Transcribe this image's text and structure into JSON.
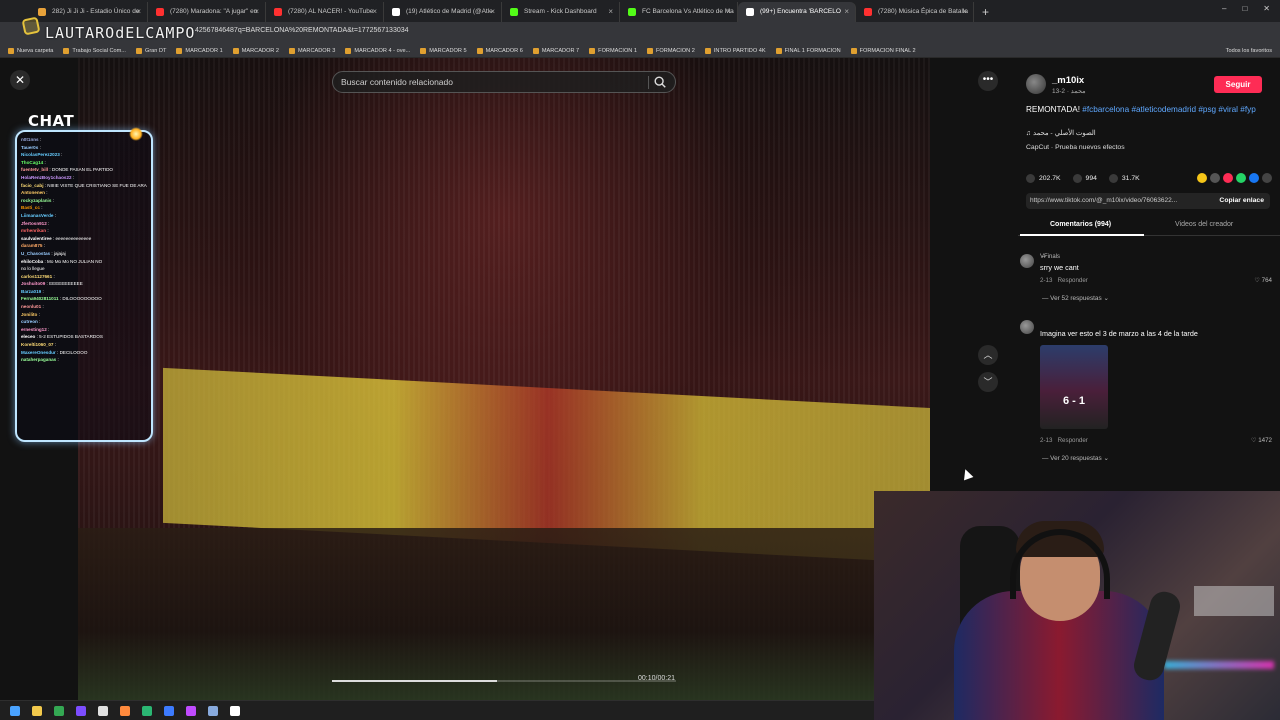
{
  "browser": {
    "tabs": [
      {
        "label": "282) Ji Ji Ji - Estadio Único de",
        "color": "#e8a23a",
        "active": false
      },
      {
        "label": "(7280) Maradona: \"A jugar\" en",
        "color": "#ff3030",
        "active": false
      },
      {
        "label": "(7280) AL NACER! - YouTube",
        "color": "#ff3030",
        "active": false
      },
      {
        "label": "(19) Atlético de Madrid (@Atle",
        "color": "#ffffff",
        "active": false
      },
      {
        "label": "Stream - Kick Dashboard",
        "color": "#53fc18",
        "active": false
      },
      {
        "label": "FC Barcelona Vs Atlético de Ma",
        "color": "#53fc18",
        "active": false
      },
      {
        "label": "(99+) Encuentra 'BARCELO",
        "color": "#ffffff",
        "active": true
      },
      {
        "label": "(7280) Música Épica de Batalla",
        "color": "#ff3030",
        "active": false
      }
    ],
    "new_tab": "+",
    "url": "42567846487q=BARCELONA%20REMONTADA&t=1772567133034",
    "streamer_overlay": "LAUTAROdELCAMPO",
    "bookmarks": [
      "Nueva carpeta",
      "Trabajo Social Com...",
      "Gran DT",
      "MARCADOR 1",
      "MARCADOR 2",
      "MARCADOR 3",
      "MARCADOR 4 - ove...",
      "MARCADOR 5",
      "MARCADOR 6",
      "MARCADOR 7",
      "FORMACION 1",
      "FORMACION 2",
      "INTRO PARTIDO 4K",
      "FINAL 1 FORMACION",
      "FORMACION FINAL 2"
    ],
    "bookmarks_right": "Todos los favoritos"
  },
  "player": {
    "search_placeholder": "Buscar contenido relacionado",
    "timecode": "00:10/00:21",
    "progress": 0.48
  },
  "chat": {
    "title": "CHAT",
    "lines": [
      {
        "user": "n0t1nns",
        "text": ":",
        "color": "#9ad"
      },
      {
        "user": "Tauer0s",
        "text": ":",
        "color": "#9cf"
      },
      {
        "user": "NicolasPerez2023",
        "text": ":",
        "color": "#6cf"
      },
      {
        "user": "ThoCag14",
        "text": ":",
        "color": "#6f6"
      },
      {
        "user": "fuentetv_bill",
        "text": ": DONDE PASAN EL PARTIDO",
        "color": "#f99"
      },
      {
        "user": "HolaRenzBoy1chaos22",
        "text": ":",
        "color": "#c9f"
      },
      {
        "user": "facio_cabj",
        "text": ": NIIIIE VISTE QUE CRISTIANO SE FUE DE ARABIA",
        "color": "#fd7"
      },
      {
        "user": "Antonenen",
        "text": ":",
        "color": "#fc6"
      },
      {
        "user": "rockyzaplanis",
        "text": ":",
        "color": "#9f9"
      },
      {
        "user": "Basti_cc",
        "text": ":",
        "color": "#f90"
      },
      {
        "user": "LiimanasVerde",
        "text": ":",
        "color": "#6cf"
      },
      {
        "user": "Jfertosn912",
        "text": ":",
        "color": "#f9c"
      },
      {
        "user": "mrhenrikan",
        "text": ":",
        "color": "#f66"
      },
      {
        "user": "saulvalentiree",
        "text": ": eeeeeeeeeeeeee",
        "color": "#fff"
      },
      {
        "user": "daram875",
        "text": ":",
        "color": "#fa6"
      },
      {
        "user": "U_Chasostas",
        "text": ": jajajaj",
        "color": "#9cf"
      },
      {
        "user": "ehiloCoba",
        "text": ": Mo Mo Mo NO JULIAN NO",
        "color": "#fff"
      },
      {
        "user": "",
        "text": "no lo llegue",
        "color": "#fff"
      },
      {
        "user": "carlos1127661",
        "text": ":",
        "color": "#fd7"
      },
      {
        "user": "Joshuito09",
        "text": ": EEEEEEEEEEE",
        "color": "#f9c"
      },
      {
        "user": "Barza019",
        "text": ":",
        "color": "#6cf"
      },
      {
        "user": "Ferna9402811011",
        "text": ": DILOOOOOOOOO",
        "color": "#9f9"
      },
      {
        "user": "neonlu01",
        "text": ":",
        "color": "#f99"
      },
      {
        "user": "Jonilito",
        "text": ":",
        "color": "#fc6"
      },
      {
        "user": "cutreon",
        "text": ":",
        "color": "#9cf"
      },
      {
        "user": "ernesting12",
        "text": ":",
        "color": "#f9c"
      },
      {
        "user": "eleceo",
        "text": ": 5-2 ESTUPIDOS BASTARDOS",
        "color": "#fff"
      },
      {
        "user": "Korelti1060_07",
        "text": ":",
        "color": "#fd7"
      },
      {
        "user": "MaxereOnesdur",
        "text": ": DECILOOOO",
        "color": "#6cf"
      },
      {
        "user": "nataherpaganas",
        "text": ":",
        "color": "#9f9"
      }
    ]
  },
  "panel": {
    "author": "_m10ix",
    "author_sub": "محمد · 2-13",
    "follow": "Seguir",
    "desc_text": "REMONTADA!",
    "desc_tags": [
      "#fcbarcelona",
      "#atleticodemadrid",
      "#psg",
      "#viral",
      "#fyp"
    ],
    "music": "♫  الصوت الأصلي - محمد",
    "effect": "CapCut · Prueba nuevos efectos",
    "likes": "202.7K",
    "comments_count": "994",
    "saves": "31.7K",
    "link": "https://www.tiktok.com/@_m10ix/video/76063622...",
    "copy_link": "Copiar enlace",
    "tab_comments": "Comentarios (994)",
    "tab_creator": "Videos del creador",
    "share_colors": [
      "#f5c518",
      "#555555",
      "#fe2c55",
      "#25d366",
      "#1877f2",
      "#444444"
    ],
    "comments": [
      {
        "user": "V̶̶Finals",
        "text": "srry we cant",
        "date": "2-13",
        "reply": "Responder",
        "likes": "764",
        "more": "Ver 52 respuestas"
      },
      {
        "user": "",
        "text": "Imagina ver esto el 3 de marzo a las 4 de la tarde",
        "date": "2-13",
        "reply": "Responder",
        "likes": "1472",
        "more": "Ver 20 respuestas",
        "image_score": "6 - 1"
      }
    ]
  },
  "taskbar": {
    "icons": [
      "windows-icon",
      "folder-icon",
      "chrome-icon",
      "app-icon",
      "obs-icon",
      "app2-icon",
      "app3-icon",
      "app4-icon",
      "app5-icon",
      "app6-icon",
      "app7-icon"
    ]
  }
}
